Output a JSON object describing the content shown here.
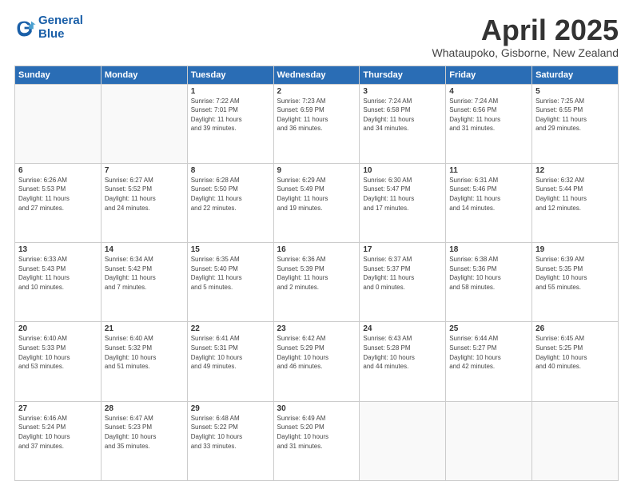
{
  "header": {
    "logo_line1": "General",
    "logo_line2": "Blue",
    "month_title": "April 2025",
    "location": "Whataupoko, Gisborne, New Zealand"
  },
  "days_of_week": [
    "Sunday",
    "Monday",
    "Tuesday",
    "Wednesday",
    "Thursday",
    "Friday",
    "Saturday"
  ],
  "weeks": [
    [
      {
        "day": "",
        "info": ""
      },
      {
        "day": "",
        "info": ""
      },
      {
        "day": "1",
        "info": "Sunrise: 7:22 AM\nSunset: 7:01 PM\nDaylight: 11 hours\nand 39 minutes."
      },
      {
        "day": "2",
        "info": "Sunrise: 7:23 AM\nSunset: 6:59 PM\nDaylight: 11 hours\nand 36 minutes."
      },
      {
        "day": "3",
        "info": "Sunrise: 7:24 AM\nSunset: 6:58 PM\nDaylight: 11 hours\nand 34 minutes."
      },
      {
        "day": "4",
        "info": "Sunrise: 7:24 AM\nSunset: 6:56 PM\nDaylight: 11 hours\nand 31 minutes."
      },
      {
        "day": "5",
        "info": "Sunrise: 7:25 AM\nSunset: 6:55 PM\nDaylight: 11 hours\nand 29 minutes."
      }
    ],
    [
      {
        "day": "6",
        "info": "Sunrise: 6:26 AM\nSunset: 5:53 PM\nDaylight: 11 hours\nand 27 minutes."
      },
      {
        "day": "7",
        "info": "Sunrise: 6:27 AM\nSunset: 5:52 PM\nDaylight: 11 hours\nand 24 minutes."
      },
      {
        "day": "8",
        "info": "Sunrise: 6:28 AM\nSunset: 5:50 PM\nDaylight: 11 hours\nand 22 minutes."
      },
      {
        "day": "9",
        "info": "Sunrise: 6:29 AM\nSunset: 5:49 PM\nDaylight: 11 hours\nand 19 minutes."
      },
      {
        "day": "10",
        "info": "Sunrise: 6:30 AM\nSunset: 5:47 PM\nDaylight: 11 hours\nand 17 minutes."
      },
      {
        "day": "11",
        "info": "Sunrise: 6:31 AM\nSunset: 5:46 PM\nDaylight: 11 hours\nand 14 minutes."
      },
      {
        "day": "12",
        "info": "Sunrise: 6:32 AM\nSunset: 5:44 PM\nDaylight: 11 hours\nand 12 minutes."
      }
    ],
    [
      {
        "day": "13",
        "info": "Sunrise: 6:33 AM\nSunset: 5:43 PM\nDaylight: 11 hours\nand 10 minutes."
      },
      {
        "day": "14",
        "info": "Sunrise: 6:34 AM\nSunset: 5:42 PM\nDaylight: 11 hours\nand 7 minutes."
      },
      {
        "day": "15",
        "info": "Sunrise: 6:35 AM\nSunset: 5:40 PM\nDaylight: 11 hours\nand 5 minutes."
      },
      {
        "day": "16",
        "info": "Sunrise: 6:36 AM\nSunset: 5:39 PM\nDaylight: 11 hours\nand 2 minutes."
      },
      {
        "day": "17",
        "info": "Sunrise: 6:37 AM\nSunset: 5:37 PM\nDaylight: 11 hours\nand 0 minutes."
      },
      {
        "day": "18",
        "info": "Sunrise: 6:38 AM\nSunset: 5:36 PM\nDaylight: 10 hours\nand 58 minutes."
      },
      {
        "day": "19",
        "info": "Sunrise: 6:39 AM\nSunset: 5:35 PM\nDaylight: 10 hours\nand 55 minutes."
      }
    ],
    [
      {
        "day": "20",
        "info": "Sunrise: 6:40 AM\nSunset: 5:33 PM\nDaylight: 10 hours\nand 53 minutes."
      },
      {
        "day": "21",
        "info": "Sunrise: 6:40 AM\nSunset: 5:32 PM\nDaylight: 10 hours\nand 51 minutes."
      },
      {
        "day": "22",
        "info": "Sunrise: 6:41 AM\nSunset: 5:31 PM\nDaylight: 10 hours\nand 49 minutes."
      },
      {
        "day": "23",
        "info": "Sunrise: 6:42 AM\nSunset: 5:29 PM\nDaylight: 10 hours\nand 46 minutes."
      },
      {
        "day": "24",
        "info": "Sunrise: 6:43 AM\nSunset: 5:28 PM\nDaylight: 10 hours\nand 44 minutes."
      },
      {
        "day": "25",
        "info": "Sunrise: 6:44 AM\nSunset: 5:27 PM\nDaylight: 10 hours\nand 42 minutes."
      },
      {
        "day": "26",
        "info": "Sunrise: 6:45 AM\nSunset: 5:25 PM\nDaylight: 10 hours\nand 40 minutes."
      }
    ],
    [
      {
        "day": "27",
        "info": "Sunrise: 6:46 AM\nSunset: 5:24 PM\nDaylight: 10 hours\nand 37 minutes."
      },
      {
        "day": "28",
        "info": "Sunrise: 6:47 AM\nSunset: 5:23 PM\nDaylight: 10 hours\nand 35 minutes."
      },
      {
        "day": "29",
        "info": "Sunrise: 6:48 AM\nSunset: 5:22 PM\nDaylight: 10 hours\nand 33 minutes."
      },
      {
        "day": "30",
        "info": "Sunrise: 6:49 AM\nSunset: 5:20 PM\nDaylight: 10 hours\nand 31 minutes."
      },
      {
        "day": "",
        "info": ""
      },
      {
        "day": "",
        "info": ""
      },
      {
        "day": "",
        "info": ""
      }
    ]
  ]
}
